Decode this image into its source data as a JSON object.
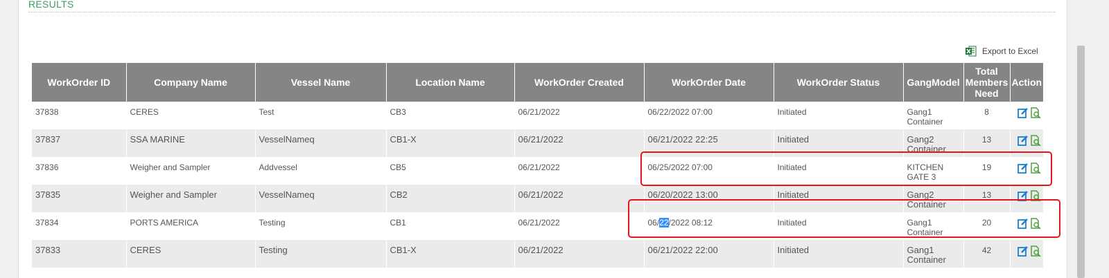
{
  "section": {
    "title": "RESULTS"
  },
  "export": {
    "label": "Export to Excel",
    "icon": "excel-icon"
  },
  "table": {
    "headers": [
      "WorkOrder ID",
      "Company Name",
      "Vessel Name",
      "Location Name",
      "WorkOrder Created",
      "WorkOrder Date",
      "WorkOrder Status",
      "GangModel",
      "Total Members Need",
      "Action"
    ],
    "rows": [
      {
        "id": "37838",
        "company": "CERES",
        "vessel": "Test",
        "location": "CB3",
        "created": "06/21/2022",
        "date": "06/22/2022 07:00",
        "status": "Initiated",
        "gang_line1": "Gang1",
        "gang_line2": "Container",
        "members": "8"
      },
      {
        "id": "37837",
        "company": "SSA MARINE",
        "vessel": "VesselNameq",
        "location": "CB1-X",
        "created": "06/21/2022",
        "date": "06/21/2022 22:25",
        "status": "Initiated",
        "gang_line1": "Gang2",
        "gang_line2": "Container",
        "members": "13"
      },
      {
        "id": "37836",
        "company": "Weigher and Sampler",
        "vessel": "Addvessel",
        "location": "CB5",
        "created": "06/21/2022",
        "date": "06/25/2022 07:00",
        "status": "Initiated",
        "gang_line1": "KITCHEN",
        "gang_line2": "GATE 3",
        "members": "19"
      },
      {
        "id": "37835",
        "company": "Weigher and Sampler",
        "vessel": "VesselNameq",
        "location": "CB2",
        "created": "06/21/2022",
        "date": "06/20/2022 13:00",
        "status": "Initiated",
        "gang_line1": "Gang2",
        "gang_line2": "Container",
        "members": "13"
      },
      {
        "id": "37834",
        "company": "PORTS AMERICA",
        "vessel": "Testing",
        "location": "CB1",
        "created": "06/21/2022",
        "date_prefix": "06/",
        "date_selected": "22",
        "date_suffix": "/2022 08:12",
        "status": "Initiated",
        "gang_line1": "Gang1",
        "gang_line2": "Container",
        "members": "20"
      },
      {
        "id": "37833",
        "company": "CERES",
        "vessel": "Testing",
        "location": "CB1-X",
        "created": "06/21/2022",
        "date": "06/21/2022 22:00",
        "status": "Initiated",
        "gang_line1": "Gang1",
        "gang_line2": "Container",
        "members": "42"
      }
    ]
  },
  "icons": {
    "edit": "edit-icon",
    "view": "view-document-icon"
  },
  "colors": {
    "header_bg": "#858585",
    "accent_green": "#3f9a5e",
    "highlight_red": "#e8141c",
    "edit_blue": "#1a7fd0",
    "view_green": "#4aa33a"
  }
}
